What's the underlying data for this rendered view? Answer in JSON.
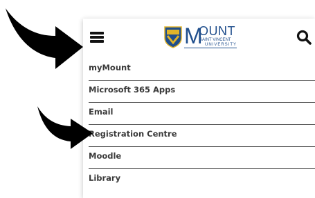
{
  "header": {
    "logo": {
      "big_letter": "M",
      "big_rest": "OUNT",
      "line1": "SAINT VINCENT",
      "line2": "UNIVERSITY"
    },
    "colors": {
      "brand": "#1f4e8c",
      "accent_gold": "#e0b42a"
    }
  },
  "icons": {
    "menu": "hamburger-icon",
    "search": "search-icon"
  },
  "menu": {
    "items": [
      {
        "label": "myMount"
      },
      {
        "label": "Microsoft 365 Apps"
      },
      {
        "label": "Email"
      },
      {
        "label": "Registration Centre"
      },
      {
        "label": "Moodle"
      },
      {
        "label": "Library"
      }
    ]
  }
}
